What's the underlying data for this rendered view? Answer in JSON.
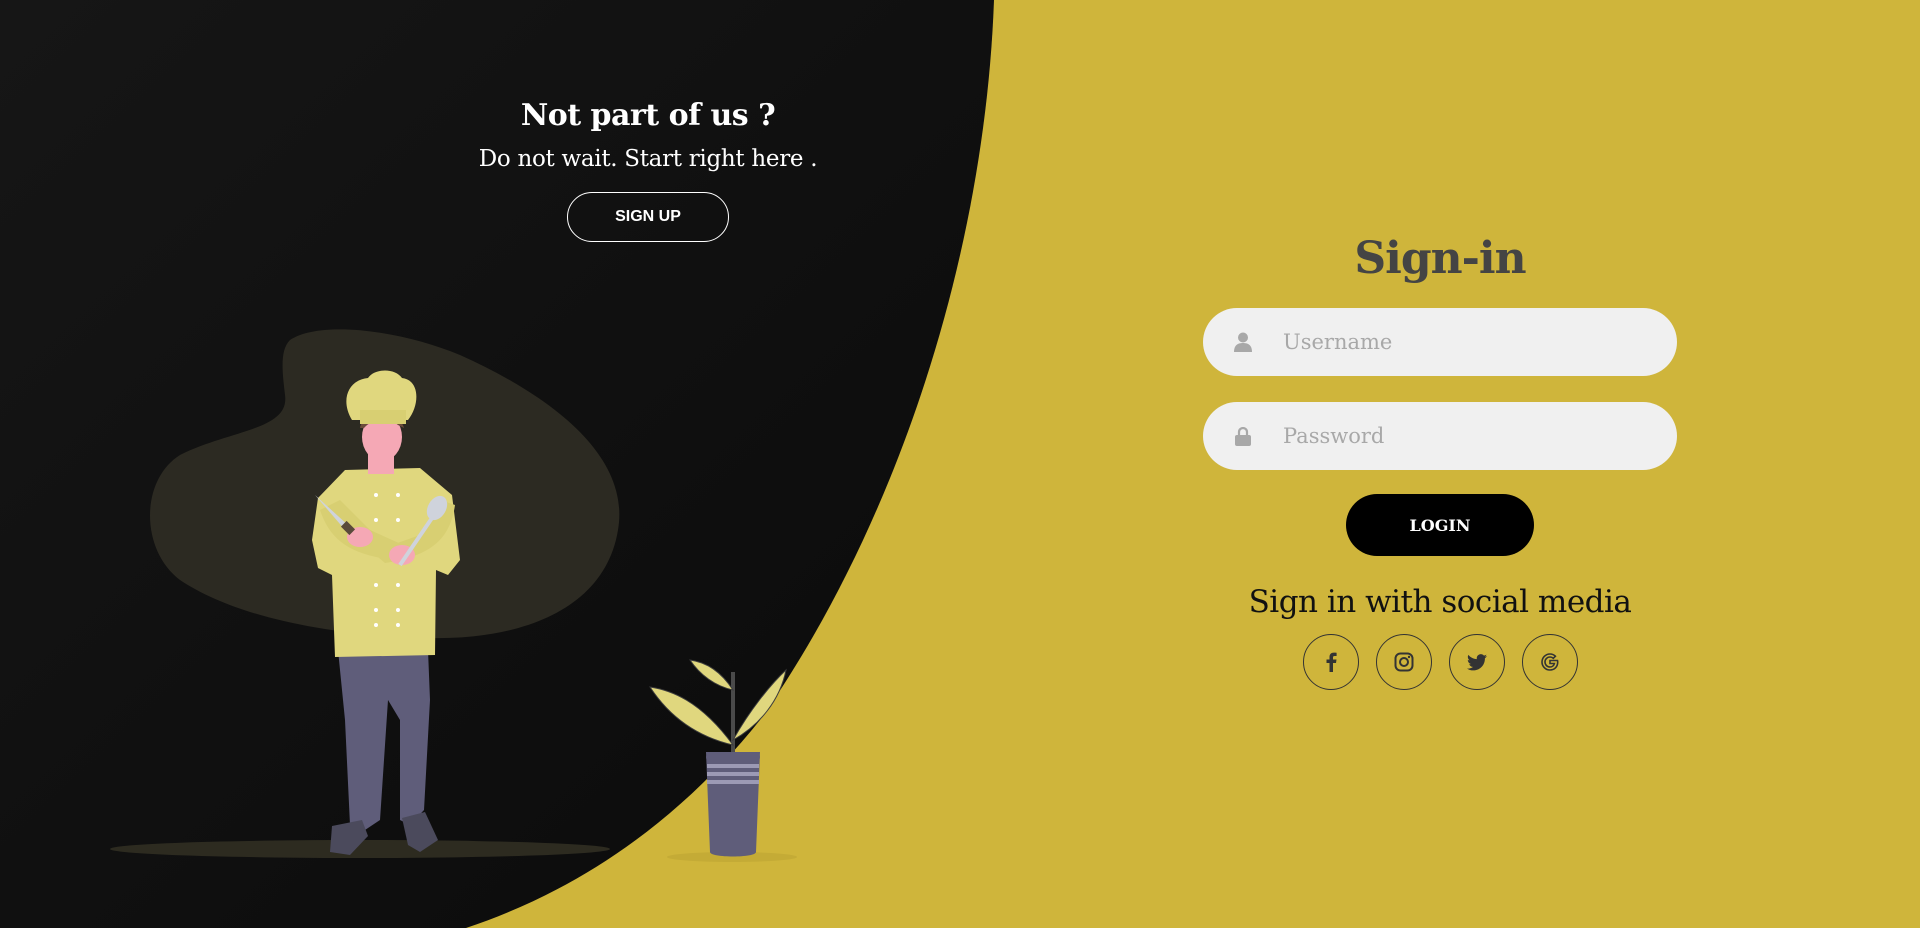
{
  "left_panel": {
    "title": "Not part of us ?",
    "subtitle": "Do not wait. Start right here .",
    "signup_label": "SIGN UP"
  },
  "signin": {
    "title": "Sign-in",
    "username_placeholder": "Username",
    "password_placeholder": "Password",
    "login_label": "LOGIN",
    "social_text": "Sign in with social media",
    "social_icons": [
      "facebook-icon",
      "instagram-icon",
      "twitter-icon",
      "google-icon"
    ]
  },
  "colors": {
    "accent": "#cfb53b",
    "dark": "#121212",
    "input_bg": "#f0f0f0",
    "chef_jacket": "#e0d77e",
    "pants": "#5f5d7a"
  }
}
